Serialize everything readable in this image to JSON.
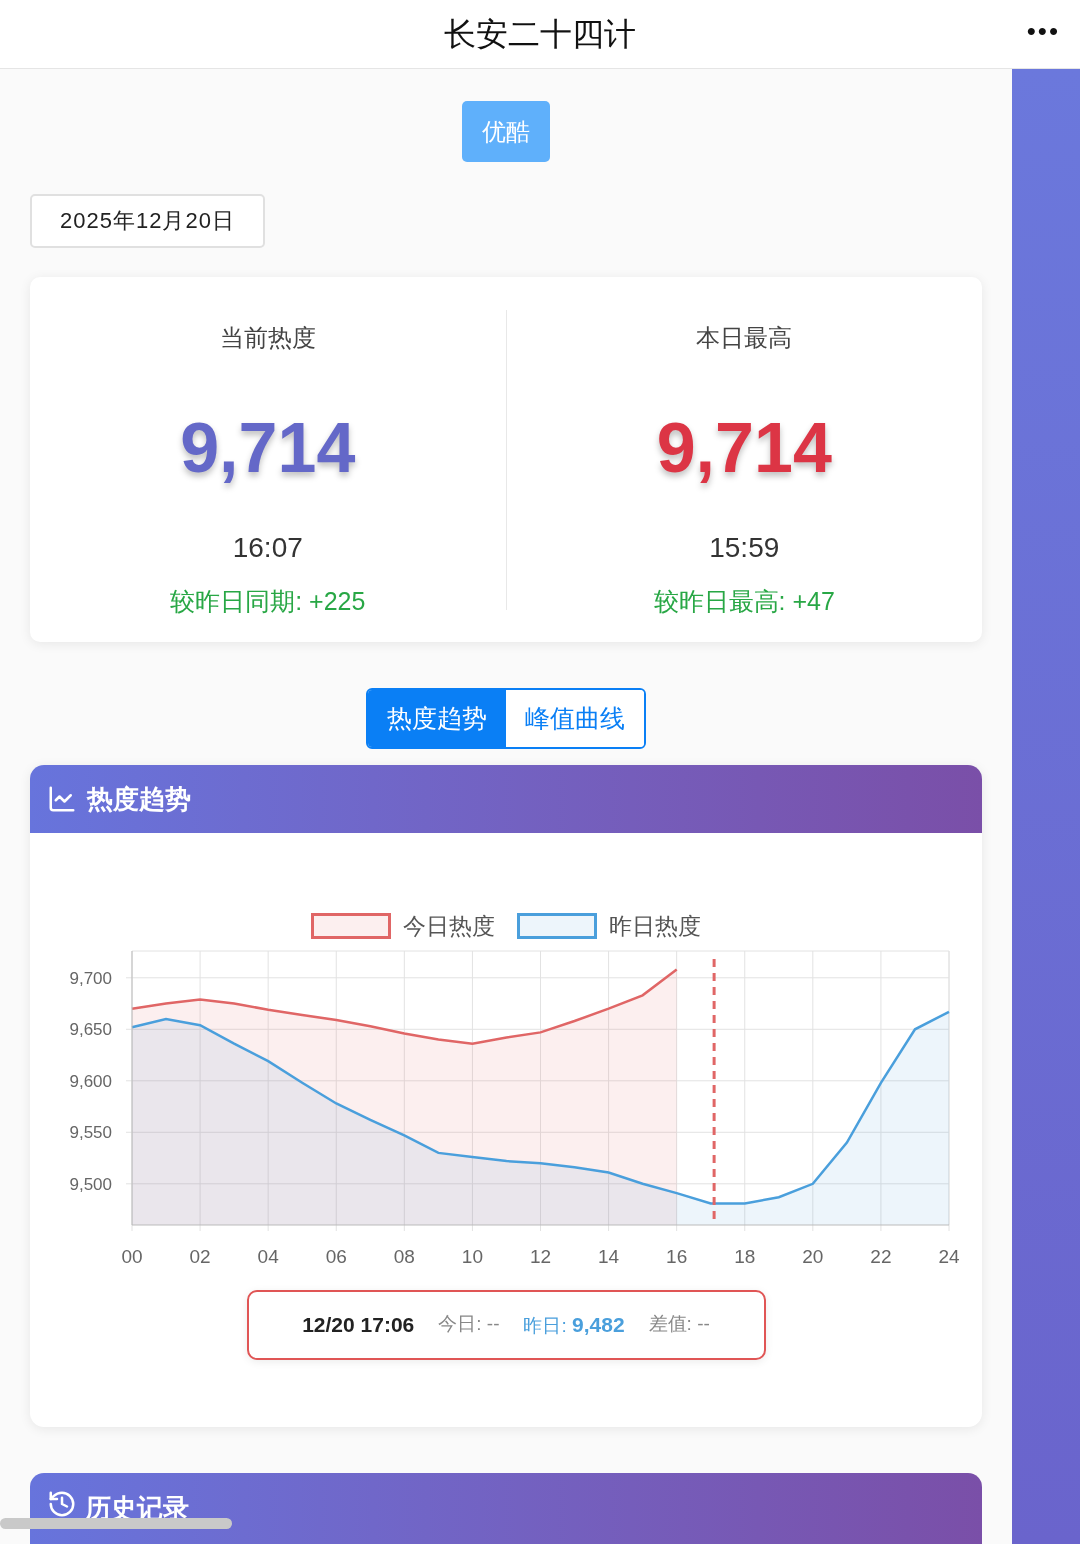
{
  "header": {
    "title": "长安二十四计",
    "menu": "•••"
  },
  "platform_button": "优酷",
  "date_field": {
    "value": "2025年12月20日"
  },
  "stats": [
    {
      "label": "当前热度",
      "value": "9,714",
      "time": "16:07",
      "delta": "较昨日同期: +225",
      "kind": "current"
    },
    {
      "label": "本日最高",
      "value": "9,714",
      "time": "15:59",
      "delta": "较昨日最高: +47",
      "kind": "peak"
    }
  ],
  "tabs": [
    {
      "label": "热度趋势",
      "selected": true
    },
    {
      "label": "峰值曲线",
      "selected": false
    }
  ],
  "trend_card": {
    "title": "热度趋势",
    "chart_data": {
      "type": "area",
      "x": [
        0,
        1,
        2,
        3,
        4,
        5,
        6,
        7,
        8,
        9,
        10,
        11,
        12,
        13,
        14,
        15,
        16,
        17,
        18,
        19,
        20,
        21,
        22,
        23,
        24
      ],
      "series": [
        {
          "name": "今日热度",
          "color": "#e06666",
          "values": [
            9670,
            9675,
            9679,
            9675,
            9669,
            9664,
            9659,
            9653,
            9646,
            9640,
            9636,
            9642,
            9647,
            9658,
            9670,
            9683,
            9708,
            null,
            null,
            null,
            null,
            null,
            null,
            null,
            null
          ]
        },
        {
          "name": "昨日热度",
          "color": "#4a9fdc",
          "values": [
            9652,
            9660,
            9654,
            9636,
            9619,
            9598,
            9578,
            9562,
            9547,
            9530,
            9526,
            9522,
            9520,
            9516,
            9511,
            9500,
            9491,
            9481,
            9481,
            9487,
            9500,
            9540,
            9598,
            9650,
            9667
          ]
        }
      ],
      "xlim": [
        0,
        24
      ],
      "ylim": [
        9460,
        9726
      ],
      "xticks": [
        {
          "value": 0,
          "label": "00"
        },
        {
          "value": 2,
          "label": "02"
        },
        {
          "value": 4,
          "label": "04"
        },
        {
          "value": 6,
          "label": "06"
        },
        {
          "value": 8,
          "label": "08"
        },
        {
          "value": 10,
          "label": "10"
        },
        {
          "value": 12,
          "label": "12"
        },
        {
          "value": 14,
          "label": "14"
        },
        {
          "value": 16,
          "label": "16"
        },
        {
          "value": 18,
          "label": "18"
        },
        {
          "value": 20,
          "label": "20"
        },
        {
          "value": 22,
          "label": "22"
        },
        {
          "value": 24,
          "label": "24"
        }
      ],
      "yticks": [
        {
          "value": 9500,
          "label": "9,500"
        },
        {
          "value": 9550,
          "label": "9,550"
        },
        {
          "value": 9600,
          "label": "9,600"
        },
        {
          "value": 9650,
          "label": "9,650"
        },
        {
          "value": 9700,
          "label": "9,700"
        }
      ],
      "grid": true,
      "ref_lines": [
        {
          "axis": "x",
          "value": 17.1,
          "color": "#e06666"
        }
      ]
    },
    "tooltip": {
      "time": "12/20 17:06",
      "items": [
        {
          "label": "今日:",
          "value": "--",
          "highlight": false
        },
        {
          "label": "昨日:",
          "value": "9,482",
          "highlight": true
        },
        {
          "label": "差值:",
          "value": "--",
          "highlight": false
        }
      ]
    }
  },
  "history_card": {
    "title": "历史记录"
  }
}
